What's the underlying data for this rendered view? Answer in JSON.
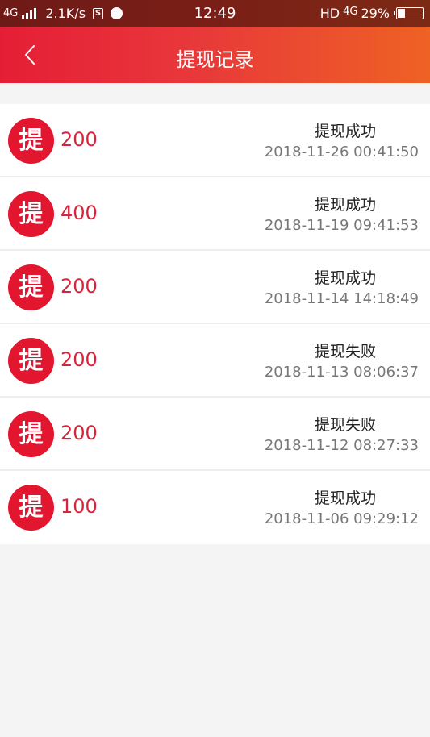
{
  "status_bar": {
    "network": "4G",
    "speed": "2.1K/s",
    "s_icon": "S",
    "time": "12:49",
    "hd": "HD",
    "network2": "4G",
    "battery": "29%",
    "battery_level": 0.29
  },
  "header": {
    "back_icon": "chevron-left",
    "title": "提现记录"
  },
  "records": [
    {
      "badge": "提",
      "amount": "200",
      "status": "提现成功",
      "datetime": "2018-11-26 00:41:50"
    },
    {
      "badge": "提",
      "amount": "400",
      "status": "提现成功",
      "datetime": "2018-11-19 09:41:53"
    },
    {
      "badge": "提",
      "amount": "200",
      "status": "提现成功",
      "datetime": "2018-11-14 14:18:49"
    },
    {
      "badge": "提",
      "amount": "200",
      "status": "提现失败",
      "datetime": "2018-11-13 08:06:37"
    },
    {
      "badge": "提",
      "amount": "200",
      "status": "提现失败",
      "datetime": "2018-11-12 08:27:33"
    },
    {
      "badge": "提",
      "amount": "100",
      "status": "提现成功",
      "datetime": "2018-11-06 09:29:12"
    }
  ],
  "colors": {
    "accent": "#e2162f",
    "amount": "#d8243a"
  }
}
